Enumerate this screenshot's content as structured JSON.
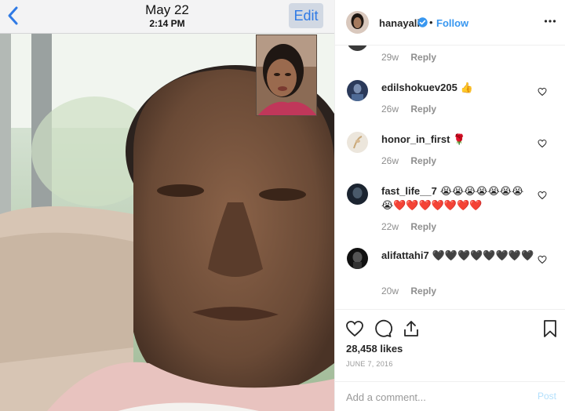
{
  "photo": {
    "date": "May 22",
    "time": "2:14 PM",
    "edit_label": "Edit",
    "back_icon": "chevron-left-icon",
    "accent": "#2f7ae5"
  },
  "post": {
    "author": "hanayali",
    "verified": true,
    "follow_separator": "•",
    "follow_label": "Follow",
    "more_icon": "ellipsis-icon",
    "follow_color": "#3897f0"
  },
  "comments": [
    {
      "user": "",
      "text": "",
      "age": "29w",
      "reply": "Reply",
      "partial": true
    },
    {
      "user": "edilshokuev205",
      "text": "👍",
      "age": "26w",
      "reply": "Reply"
    },
    {
      "user": "honor_in_first",
      "text": "🌹",
      "age": "26w",
      "reply": "Reply"
    },
    {
      "user": "fast_life__7",
      "text": "😭😭😭😭😭😭😭😭❤️❤️❤️❤️❤️❤️❤️",
      "age": "22w",
      "reply": "Reply"
    },
    {
      "user": "alifattahi7",
      "text": "🖤🖤🖤🖤🖤🖤🖤🖤",
      "age": "20w",
      "reply": "Reply"
    }
  ],
  "actions": {
    "icons": [
      "heart-icon",
      "comment-icon",
      "share-icon",
      "bookmark-icon"
    ],
    "likes": "28,458 likes",
    "date": "JUNE 7, 2016"
  },
  "add_comment": {
    "placeholder": "Add a comment...",
    "post_label": "Post",
    "post_color": "#b2dffc"
  }
}
